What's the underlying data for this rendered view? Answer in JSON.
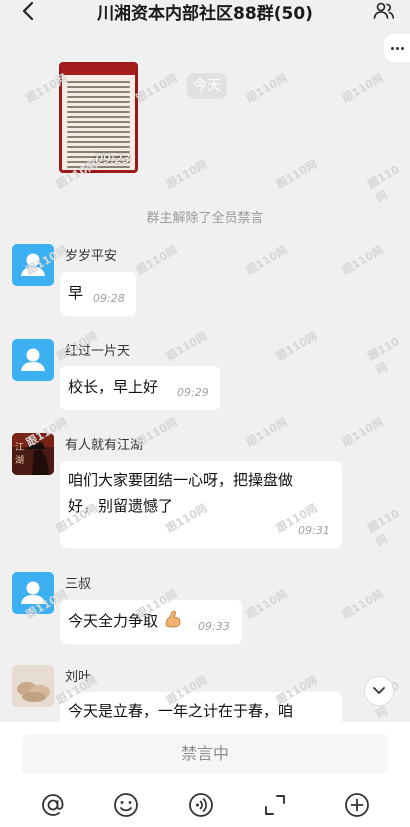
{
  "header": {
    "title": "川湘资本内部社区88群(50)"
  },
  "date_divider": "今天",
  "shared_image": {
    "time": "09:23"
  },
  "system_message": "群主解除了全员禁言",
  "messages": [
    {
      "sender": "岁岁平安",
      "lines": [
        "早"
      ],
      "time": "09:28"
    },
    {
      "sender": "红过一片天",
      "lines": [
        "校长，早上好"
      ],
      "time": "09:29"
    },
    {
      "sender": "有人就有江湖",
      "lines": [
        "咱们大家要团结一心呀，把操盘做",
        "好，别留遗憾了"
      ],
      "time": "09:31"
    },
    {
      "sender": "三叔",
      "lines": [
        "今天全力争取"
      ],
      "time": "09:33"
    },
    {
      "sender": "刘叶",
      "lines": [
        "今天是立春，一年之计在于春，咱"
      ]
    }
  ],
  "avatar_art": {
    "jianghu_char1": "江",
    "jianghu_char2": "湖"
  },
  "watermark": "跟110网",
  "input_bar": {
    "placeholder": "禁言中"
  },
  "toolbar": {
    "icons": [
      "at-icon",
      "emoji-icon",
      "voice-icon",
      "expand-icon",
      "plus-icon"
    ]
  },
  "colors": {
    "default_avatar": "#3cb0f0",
    "bubble": "#ffffff",
    "background": "#f0f0f0",
    "muted_text": "#9a9a9a"
  }
}
